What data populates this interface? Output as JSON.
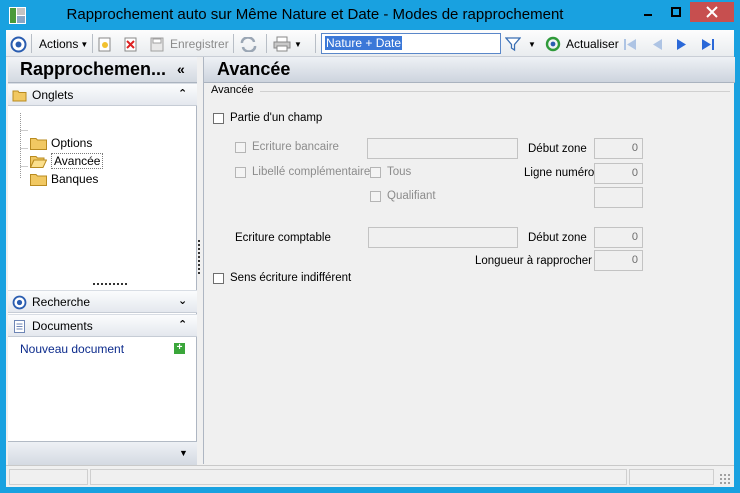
{
  "window": {
    "title": "Rapprochement auto sur Même Nature et Date -  Modes de rapprochement",
    "controls": {
      "minimize": "minimize-icon",
      "maximize": "maximize-icon",
      "close": "close-icon"
    }
  },
  "toolbar": {
    "actions_label": "Actions",
    "save_label": "Enregistrer",
    "filter_value": "Nature + Date",
    "refresh_label": "Actualiser"
  },
  "left_panel": {
    "title": "Rapprochemen...",
    "collapse_glyph": "«",
    "tabs_header": "Onglets",
    "tree": [
      "Options",
      "Avancée",
      "Banques"
    ],
    "selected": "Avancée",
    "search_header": "Recherche",
    "documents_header": "Documents",
    "new_document": "Nouveau document"
  },
  "right_panel": {
    "title": "Avancée",
    "group_title": "Avancée",
    "partie_champ": "Partie d'un champ",
    "ecriture_bancaire": "Ecriture bancaire",
    "libelle_complementaire": "Libellé complémentaire",
    "tous": "Tous",
    "qualifiant": "Qualifiant",
    "debut_zone_1": "Début zone",
    "debut_zone_1_value": "0",
    "ligne_numero": "Ligne numéro",
    "ligne_numero_value": "0",
    "qualifiant_value": "",
    "ecriture_comptable": "Ecriture comptable",
    "debut_zone_2": "Début zone",
    "debut_zone_2_value": "0",
    "longueur": "Longueur à rapprocher",
    "longueur_value": "0",
    "sens_indifferent": "Sens écriture indifférent"
  },
  "colors": {
    "title_bar": "#19a1e0",
    "close_button": "#c74f4f",
    "selection": "#3b78d8",
    "link": "#0c2b8c"
  }
}
